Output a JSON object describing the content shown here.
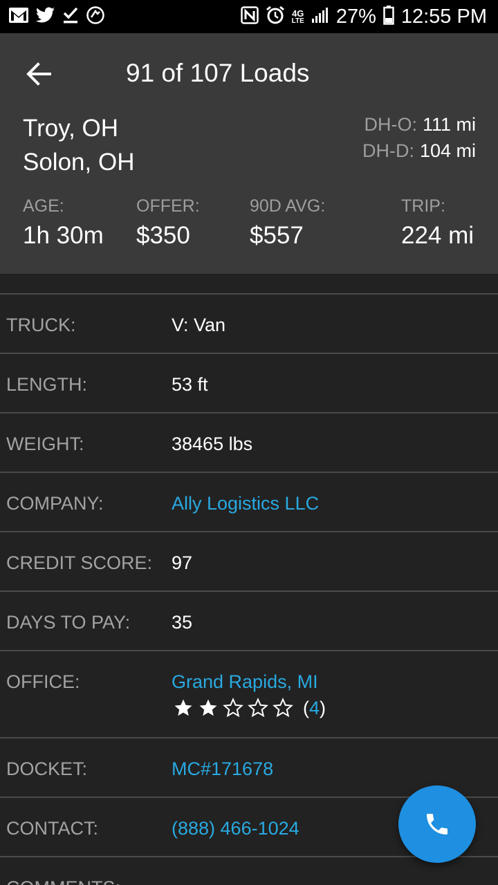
{
  "status_bar": {
    "left_icons": [
      "gmail-icon",
      "twitter-icon",
      "download-done-icon",
      "sync-icon"
    ],
    "right_icons": [
      "nfc-icon",
      "alarm-icon",
      "lte-icon",
      "signal-icon",
      "battery-icon"
    ],
    "network_top": "4G",
    "network_bottom": "LTE",
    "battery": "27%",
    "time": "12:55 PM"
  },
  "header": {
    "title": "91 of 107 Loads",
    "origin": "Troy, OH",
    "destination": "Solon, OH",
    "dh_o_label": "DH-O:",
    "dh_o_value": "111 mi",
    "dh_d_label": "DH-D:",
    "dh_d_value": "104 mi",
    "stats": {
      "age_label": "AGE:",
      "age_value": "1h 30m",
      "offer_label": "OFFER:",
      "offer_value": "$350",
      "avg_label": "90D AVG:",
      "avg_value": "$557",
      "trip_label": "TRIP:",
      "trip_value": "224 mi"
    }
  },
  "details": {
    "truck_label": "TRUCK:",
    "truck_value": "V: Van",
    "length_label": "LENGTH:",
    "length_value": "53 ft",
    "weight_label": "WEIGHT:",
    "weight_value": "38465 lbs",
    "company_label": "COMPANY:",
    "company_value": "Ally Logistics LLC",
    "credit_label": "CREDIT SCORE:",
    "credit_value": "97",
    "days_label": "DAYS TO PAY:",
    "days_value": "35",
    "office_label": "OFFICE:",
    "office_value": "Grand Rapids, MI",
    "office_rating": 2,
    "office_rating_max": 5,
    "office_review_open": "(",
    "office_review_count": "4",
    "office_review_close": ")",
    "docket_label": "DOCKET:",
    "docket_value": "MC#171678",
    "contact_label": "CONTACT:",
    "contact_value": "(888) 466-1024",
    "comments_label": "COMMENTS:"
  },
  "fab": {
    "icon": "phone-icon"
  },
  "colors": {
    "background": "#222222",
    "header_bg": "#3a3a3a",
    "link": "#29a9e1",
    "fab": "#1e8fe1",
    "label": "#a3a3a3"
  }
}
